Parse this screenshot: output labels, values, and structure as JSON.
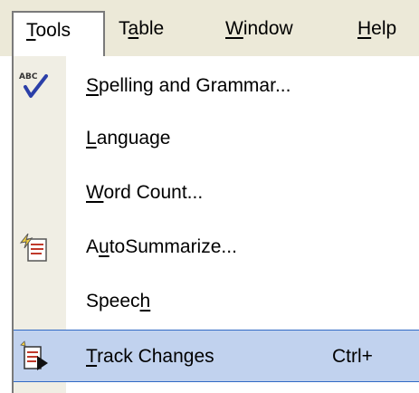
{
  "menubar": {
    "tools": {
      "before": "",
      "u": "T",
      "after": "ools"
    },
    "table": {
      "before": "T",
      "u": "a",
      "after": "ble"
    },
    "window": {
      "before": "",
      "u": "W",
      "after": "indow"
    },
    "help": {
      "before": "",
      "u": "H",
      "after": "elp"
    }
  },
  "menu": {
    "items": [
      {
        "before": "",
        "u": "S",
        "after": "pelling and Grammar...",
        "icon": "spelling-check-icon",
        "badge": "ABC"
      },
      {
        "before": "",
        "u": "L",
        "after": "anguage"
      },
      {
        "before": "",
        "u": "W",
        "after": "ord Count..."
      },
      {
        "before": "A",
        "u": "u",
        "after": "toSummarize...",
        "icon": "autosummarize-icon"
      },
      {
        "before": "Speec",
        "u": "h",
        "after": ""
      },
      {
        "before": "",
        "u": "T",
        "after": "rack Changes",
        "shortcut": "Ctrl+",
        "icon": "track-changes-icon"
      }
    ]
  },
  "colors": {
    "menubar_bg": "#ece9d8",
    "highlight_bg": "#c1d2ee",
    "highlight_border": "#316ac5"
  }
}
